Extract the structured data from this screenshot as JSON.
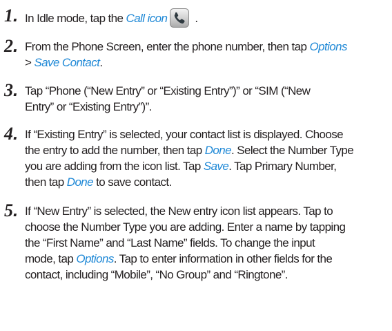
{
  "steps": [
    {
      "number": "1",
      "before": "In Idle mode, tap the ",
      "link": "Call icon",
      "after": " ."
    },
    {
      "number": "2",
      "line1_before": "From the Phone Screen, enter the phone number, then tap ",
      "line1_link": "Options",
      "line2_before": "> ",
      "line2_link": "Save Contact",
      "line2_after": "."
    },
    {
      "number": "3",
      "line1": "Tap “Phone (“New Entry” or “Existing Entry”)” or “SIM (“New",
      "line2": "Entry” or “Existing Entry”)”."
    },
    {
      "number": "4",
      "line1": "If “Existing Entry” is selected, your contact list is displayed. Choose",
      "line2_before": "the entry to add the number, then tap ",
      "line2_link": "Done",
      "line2_after": ". Select the Number Type",
      "line3_before": "you are adding from the icon list. Tap ",
      "line3_link": "Save",
      "line3_after": ". Tap Primary Number,",
      "line4_before": "then tap ",
      "line4_link": "Done",
      "line4_after": " to save contact."
    },
    {
      "number": "5",
      "line1": "If “New Entry” is selected, the New entry icon list appears. Tap to",
      "line2": "choose the Number Type you are adding. Enter a name by tapping",
      "line3": "the “First Name” and “Last Name” fields. To change the input",
      "line4_before": "mode, tap ",
      "line4_link": "Options",
      "line4_after": ". Tap to enter information in other fields for the",
      "line5": "contact, including “Mobile”, “No Group” and “Ringtone”."
    }
  ],
  "colors": {
    "text": "#231f20",
    "link": "#1e88d6"
  },
  "icons": {
    "call": "phone-handset-icon"
  }
}
